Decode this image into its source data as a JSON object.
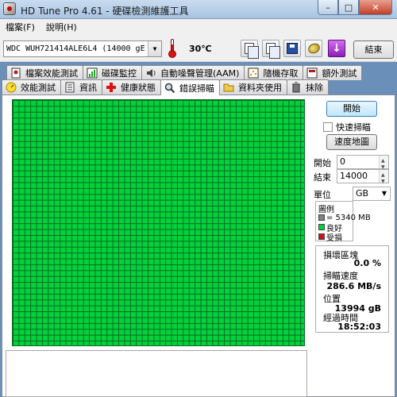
{
  "window": {
    "title": "HD Tune Pro 4.61 - 硬碟檢測維護工具",
    "controls": {
      "minimize": "–",
      "maximize": "□",
      "close": "✕"
    }
  },
  "menu": [
    "檔案(F)",
    "說明(H)"
  ],
  "toolbar": {
    "drive": "WDC  WUH721414ALE6L4   (14000 gE",
    "temperature": "30℃",
    "exit_label": "結束",
    "icons": [
      "copy-text-icon",
      "copy-screenshot-icon",
      "save-icon",
      "options-coins-icon",
      "exit-arrow-icon"
    ]
  },
  "tabs": {
    "row1": [
      {
        "label": "檔案效能測試",
        "icon": "file-benchmark-icon"
      },
      {
        "label": "磁碟監控",
        "icon": "disk-monitor-icon"
      },
      {
        "label": "自動噪聲管理(AAM)",
        "icon": "speaker-icon"
      },
      {
        "label": "隨機存取",
        "icon": "random-access-icon"
      },
      {
        "label": "額外測試",
        "icon": "extra-tests-icon"
      }
    ],
    "row2": [
      {
        "label": "效能測試",
        "icon": "benchmark-icon"
      },
      {
        "label": "資訊",
        "icon": "info-icon"
      },
      {
        "label": "健康狀態",
        "icon": "health-cross-icon"
      },
      {
        "label": "錯誤掃瞄",
        "icon": "magnifier-icon",
        "active": true
      },
      {
        "label": "資料夾使用",
        "icon": "folder-icon"
      },
      {
        "label": "抹除",
        "icon": "trash-icon"
      }
    ]
  },
  "scan": {
    "start_button": "開始",
    "quick_scan_label": "快速掃瞄",
    "quick_scan_checked": false,
    "speed_map_button": "速度地圖",
    "start_label": "開始",
    "start_value": "0",
    "end_label": "結束",
    "end_value": "14000",
    "unit_label": "單位",
    "unit_value": "GB",
    "legend": {
      "title": "圖例",
      "block_size": "= 5340 MB",
      "good": "良好",
      "damaged": "受損",
      "colors": {
        "block": "#808080",
        "good": "#00d23c",
        "damaged": "#d01020"
      }
    },
    "stats": {
      "damaged_blocks_label": "損壞區塊",
      "damaged_blocks_value": "0.0 %",
      "scan_speed_label": "掃瞄速度",
      "scan_speed_value": "286.6 MB/s",
      "position_label": "位置",
      "position_value": "13994 gB",
      "elapsed_label": "經過時間",
      "elapsed_value": "18:52:03"
    },
    "progress_fraction": 1.0
  },
  "colors": {
    "grid_good": "#00d23c",
    "grid_line": "#0e6a22"
  }
}
